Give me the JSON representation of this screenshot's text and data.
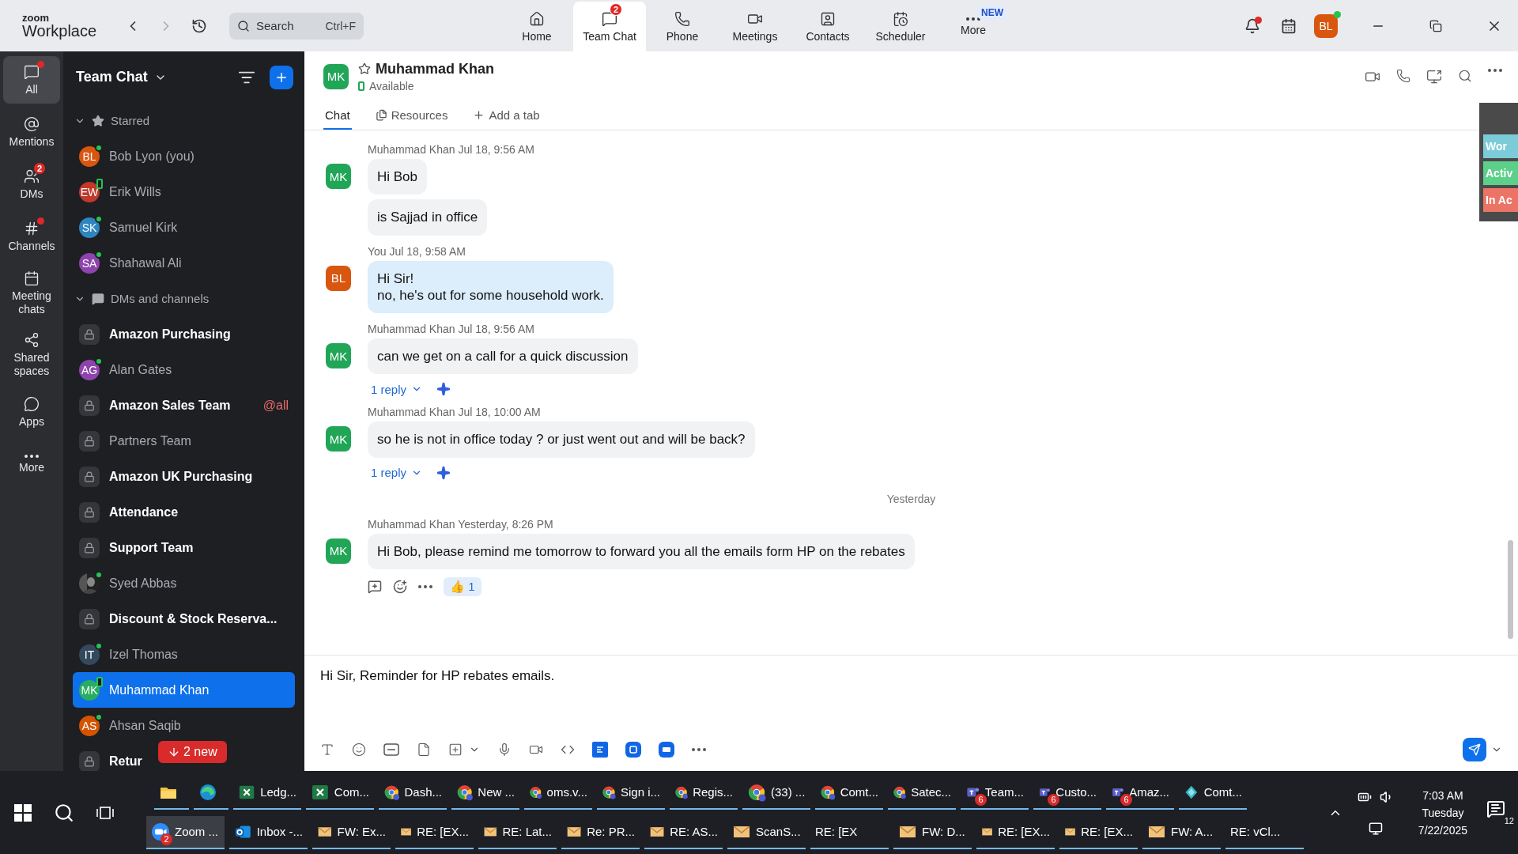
{
  "app": {
    "brand_top": "zoom",
    "brand_bottom": "Workplace",
    "search_placeholder": "Search",
    "search_shortcut": "Ctrl+F"
  },
  "nav": [
    {
      "label": "Home",
      "selected": false
    },
    {
      "label": "Team Chat",
      "selected": true,
      "badge": "2"
    },
    {
      "label": "Phone",
      "selected": false
    },
    {
      "label": "Meetings",
      "selected": false
    },
    {
      "label": "Contacts",
      "selected": false
    },
    {
      "label": "Scheduler",
      "selected": false
    },
    {
      "label": "More",
      "selected": false,
      "tag": "NEW"
    }
  ],
  "profile": {
    "initials": "BL",
    "color": "#d9560f",
    "notification_dot": true
  },
  "rail": [
    {
      "label": "All",
      "selected": true,
      "dot": true
    },
    {
      "label": "Mentions",
      "selected": false,
      "dot": false
    },
    {
      "label": "DMs",
      "selected": false,
      "dot": false,
      "badge": "2"
    },
    {
      "label": "Channels",
      "selected": false,
      "dot": true
    },
    {
      "label": "Meeting chats",
      "selected": false,
      "dot": false
    },
    {
      "label": "Shared spaces",
      "selected": false,
      "dot": false
    },
    {
      "label": "Apps",
      "selected": false,
      "dot": false
    },
    {
      "label": "More",
      "selected": false,
      "dot": false
    }
  ],
  "sidebar": {
    "title": "Team Chat",
    "new_count": "2 new",
    "sections": [
      {
        "title": "Starred",
        "expanded": true,
        "items": [
          {
            "kind": "person",
            "name": "Bob Lyon (you)",
            "initials": "BL",
            "color": "#d9560f",
            "online": true,
            "mobile": false,
            "unread": false,
            "selected": false
          },
          {
            "kind": "person",
            "name": "Erik Wills",
            "initials": "EW",
            "color": "#c0392b",
            "online": true,
            "mobile": true,
            "unread": false,
            "selected": false
          },
          {
            "kind": "person",
            "name": "Samuel Kirk",
            "initials": "SK",
            "color": "#2e86c1",
            "online": true,
            "mobile": false,
            "unread": false,
            "selected": false
          },
          {
            "kind": "person",
            "name": "Shahawal Ali",
            "initials": "SA",
            "color": "#8e44ad",
            "online": true,
            "mobile": false,
            "unread": false,
            "selected": false
          }
        ]
      },
      {
        "title": "DMs and channels",
        "expanded": true,
        "items": [
          {
            "kind": "channel",
            "name": "Amazon Purchasing",
            "unread": true,
            "selected": false
          },
          {
            "kind": "person",
            "name": "Alan Gates",
            "initials": "AG",
            "color": "#8e44ad",
            "online": true,
            "mobile": false,
            "unread": false,
            "selected": false
          },
          {
            "kind": "channel",
            "name": "Amazon Sales Team",
            "unread": true,
            "selected": false,
            "mention": "@all"
          },
          {
            "kind": "channel",
            "name": "Partners Team",
            "unread": false,
            "selected": false
          },
          {
            "kind": "channel",
            "name": "Amazon UK Purchasing",
            "unread": true,
            "selected": false
          },
          {
            "kind": "channel",
            "name": "Attendance",
            "unread": true,
            "selected": false
          },
          {
            "kind": "channel",
            "name": "Support Team",
            "unread": true,
            "selected": false
          },
          {
            "name": "Syed Abbas",
            "online": true,
            "mobile": false,
            "unread": false,
            "selected": false
          },
          {
            "kind": "channel",
            "name": "Discount & Stock Reserva...",
            "unread": true,
            "selected": false
          },
          {
            "kind": "person",
            "name": "Izel Thomas",
            "initials": "IT",
            "color": "#34495e",
            "online": true,
            "mobile": false,
            "unread": false,
            "selected": false
          },
          {
            "kind": "person",
            "name": "Muhammad Khan",
            "initials": "MK",
            "color": "#27ae60",
            "online": true,
            "mobile": true,
            "unread": false,
            "selected": true
          },
          {
            "kind": "person",
            "name": "Ahsan Saqib",
            "initials": "AS",
            "color": "#d35400",
            "online": true,
            "mobile": false,
            "unread": false,
            "selected": false
          },
          {
            "kind": "channel",
            "name": "Retur",
            "unread": true,
            "selected": false
          }
        ]
      }
    ]
  },
  "chat": {
    "contact": {
      "initials": "MK",
      "color": "#21a557",
      "name": "Muhammad Khan",
      "status": "Available",
      "starred": false
    },
    "tabs": [
      {
        "label": "Chat",
        "selected": true
      },
      {
        "label": "Resources",
        "selected": false
      },
      {
        "label": "Add a tab",
        "selected": false
      }
    ],
    "messages": [
      {
        "kind": "message",
        "sender": "Muhammad Khan",
        "time": "Jul 18, 9:56 AM",
        "initials": "MK",
        "color": "#21a557",
        "mine": false,
        "bubbles": [
          "Hi Bob",
          "is Sajjad in office"
        ]
      },
      {
        "kind": "message",
        "sender": "You",
        "time": "Jul 18, 9:58 AM",
        "initials": "BL",
        "color": "#d9560f",
        "mine": true,
        "bubbles": [
          "Hi Sir!\nno, he's out for some household work."
        ]
      },
      {
        "kind": "message",
        "sender": "Muhammad Khan",
        "time": "Jul 18, 9:56 AM",
        "initials": "MK",
        "color": "#21a557",
        "mine": false,
        "bubbles": [
          "can we get on a call for a quick discussion"
        ],
        "replies": "1 reply"
      },
      {
        "kind": "message",
        "sender": "Muhammad Khan",
        "time": "Jul 18, 10:00 AM",
        "initials": "MK",
        "color": "#21a557",
        "mine": false,
        "bubbles": [
          "so he is not in office today ? or just went out and will be back?"
        ],
        "replies": "1 reply"
      },
      {
        "kind": "divider",
        "label": "Yesterday"
      },
      {
        "kind": "message",
        "sender": "Muhammad Khan",
        "time": "Yesterday, 8:26 PM",
        "initials": "MK",
        "color": "#21a557",
        "mine": false,
        "hover": true,
        "bubbles": [
          "Hi Bob, please remind me tomorrow to forward you all the emails form HP on the rebates"
        ],
        "reaction": {
          "emoji": "👍",
          "count": "1"
        }
      }
    ],
    "draft": "Hi Sir, Reminder for HP rebates emails."
  },
  "side_panel": [
    {
      "label": "Wor",
      "color": "#7ccbd8"
    },
    {
      "label": "Activ",
      "color": "#5cd08a"
    },
    {
      "label": "In Ac",
      "color": "#ec7466"
    }
  ],
  "taskbar": {
    "top_row": [
      {
        "kind": "explorer",
        "active": false
      },
      {
        "kind": "edge",
        "active": false
      },
      {
        "kind": "excel",
        "label": "Ledg...",
        "active": false
      },
      {
        "kind": "excel",
        "label": "Com...",
        "active": false
      },
      {
        "kind": "chrome",
        "label": "Dash...",
        "active": false
      },
      {
        "kind": "chrome",
        "label": "New ...",
        "active": false
      },
      {
        "kind": "chrome",
        "label": "oms.v...",
        "active": false
      },
      {
        "kind": "chrome",
        "label": "Sign i...",
        "active": false
      },
      {
        "kind": "chrome",
        "label": "Regis...",
        "active": false
      },
      {
        "kind": "chrome",
        "label": "(33) ...",
        "active": false
      },
      {
        "kind": "chrome",
        "label": "Comt...",
        "active": false
      },
      {
        "kind": "chrome",
        "label": "Satec...",
        "active": false
      },
      {
        "kind": "teams",
        "label": "Team...",
        "badge": "6",
        "active": false
      },
      {
        "kind": "teams",
        "label": "Custo...",
        "badge": "6",
        "active": false
      },
      {
        "kind": "teams",
        "label": "Amaz...",
        "badge": "6",
        "active": false
      },
      {
        "kind": "diamond",
        "label": "Comt...",
        "active": false
      }
    ],
    "bottom_row": [
      {
        "kind": "zoom",
        "label": "Zoom ...",
        "badge": "2",
        "active": true
      },
      {
        "kind": "outlook",
        "label": "Inbox -...",
        "active": false
      },
      {
        "kind": "mail",
        "label": "FW: Ex...",
        "active": false
      },
      {
        "kind": "mail",
        "label": "RE: [EX...",
        "active": false
      },
      {
        "kind": "mail",
        "label": "RE: Lat...",
        "active": false
      },
      {
        "kind": "mail",
        "label": "Re: PR...",
        "active": false
      },
      {
        "kind": "mail",
        "label": "RE: AS...",
        "active": false
      },
      {
        "kind": "mail",
        "label": "ScanS...",
        "active": false
      },
      {
        "kind": "none",
        "label": "RE: [EX",
        "active": false
      },
      {
        "kind": "mail",
        "label": "FW: D...",
        "active": false
      },
      {
        "kind": "mail",
        "label": "RE: [EX...",
        "active": false
      },
      {
        "kind": "mail",
        "label": "RE: [EX...",
        "active": false
      },
      {
        "kind": "mail",
        "label": "FW: A...",
        "active": false
      },
      {
        "kind": "none",
        "label": "RE: vCl...",
        "active": false
      }
    ],
    "tray": {
      "time": "7:03 AM",
      "day": "Tuesday",
      "date": "7/22/2025",
      "notifications": "12"
    }
  }
}
